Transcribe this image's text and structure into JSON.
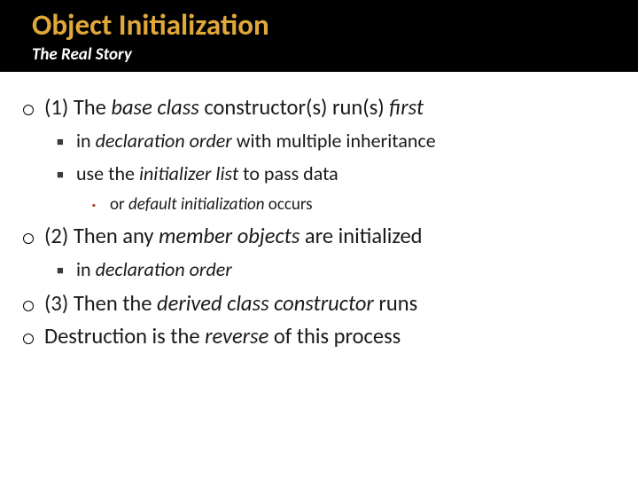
{
  "header": {
    "title": "Object Initialization",
    "subtitle": "The Real Story"
  },
  "items": [
    {
      "level": 1,
      "segments": [
        {
          "t": "(1) The "
        },
        {
          "t": "base class",
          "i": true
        },
        {
          "t": " constructor(s) run(s) "
        },
        {
          "t": "first",
          "i": true
        }
      ]
    },
    {
      "level": 2,
      "segments": [
        {
          "t": "in "
        },
        {
          "t": "declaration order",
          "i": true
        },
        {
          "t": " with multiple inheritance"
        }
      ]
    },
    {
      "level": 2,
      "segments": [
        {
          "t": "use the "
        },
        {
          "t": "initializer list",
          "i": true
        },
        {
          "t": " to pass data"
        }
      ]
    },
    {
      "level": 3,
      "segments": [
        {
          "t": "or "
        },
        {
          "t": "default initialization",
          "i": true
        },
        {
          "t": " occurs"
        }
      ]
    },
    {
      "level": 1,
      "segments": [
        {
          "t": "(2) Then any "
        },
        {
          "t": "member objects",
          "i": true
        },
        {
          "t": " are initialized"
        }
      ]
    },
    {
      "level": 2,
      "segments": [
        {
          "t": "in "
        },
        {
          "t": "declaration order",
          "i": true
        }
      ]
    },
    {
      "level": 1,
      "segments": [
        {
          "t": "(3) Then the "
        },
        {
          "t": "derived class constructor",
          "i": true
        },
        {
          "t": " runs"
        }
      ]
    },
    {
      "level": 1,
      "segments": [
        {
          "t": "Destruction is the "
        },
        {
          "t": "reverse",
          "i": true
        },
        {
          "t": " of this process"
        }
      ]
    }
  ]
}
